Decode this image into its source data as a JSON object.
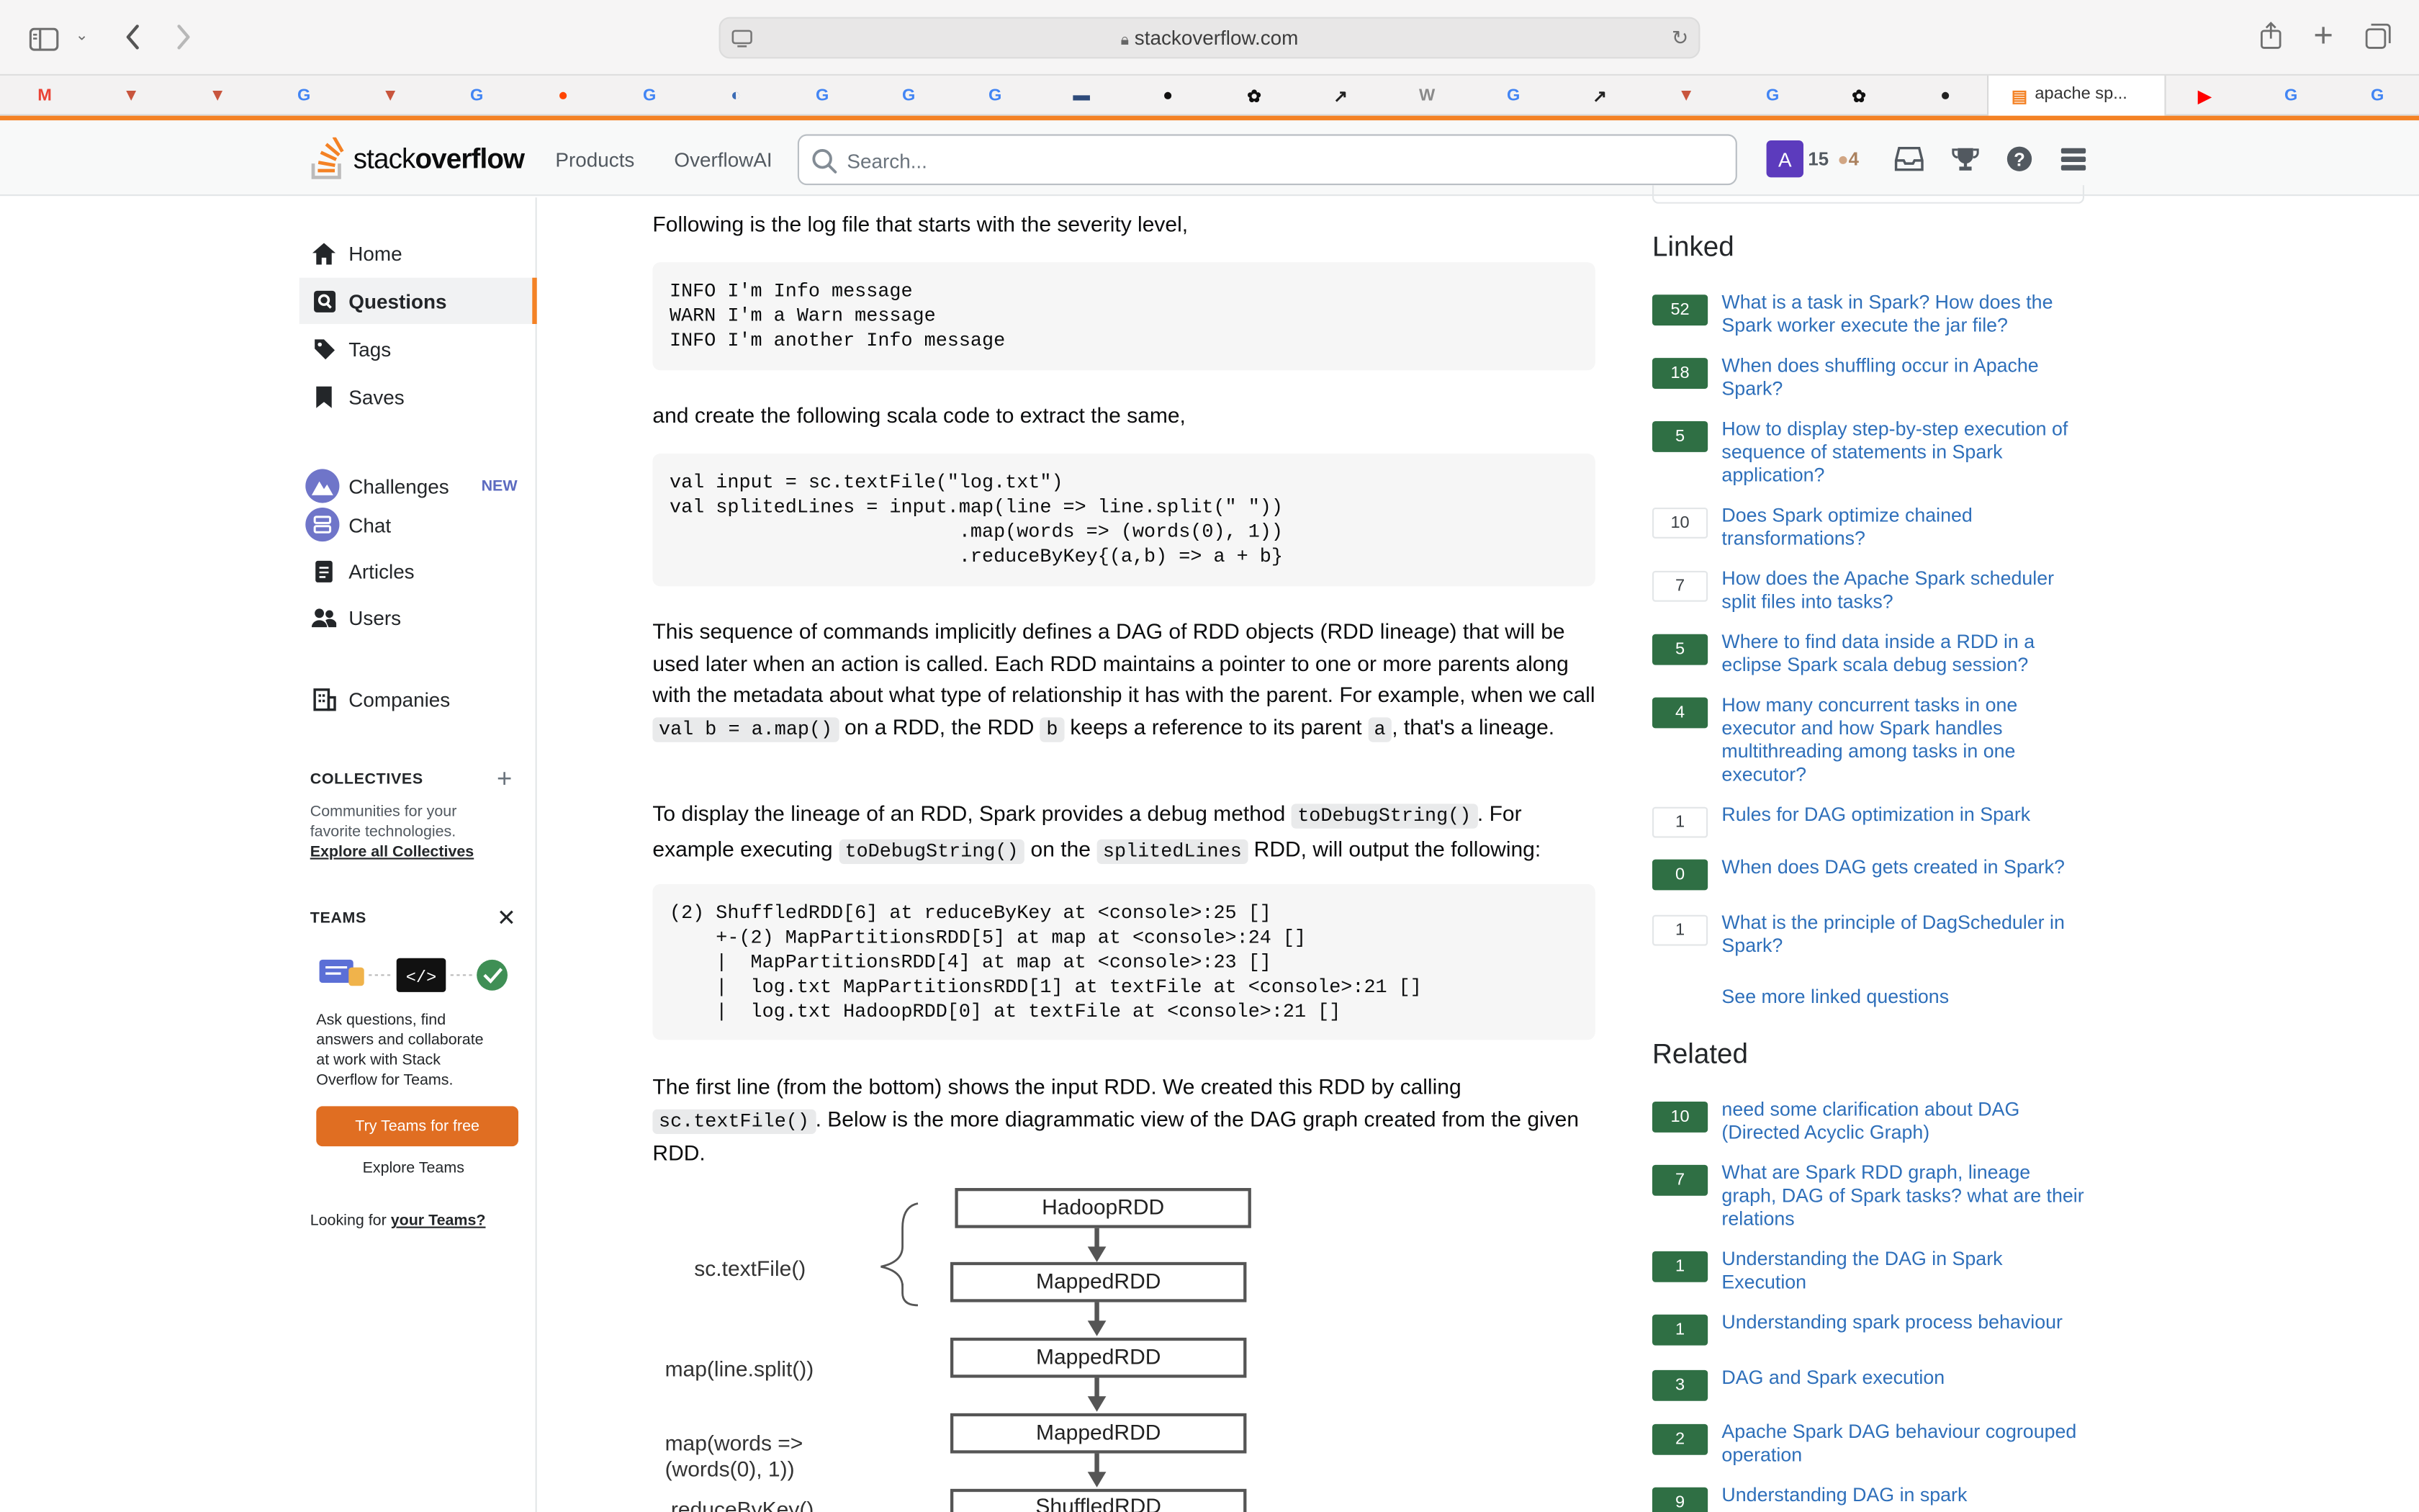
{
  "browser": {
    "url": "stackoverflow.com",
    "active_tab_label": "apache sp...",
    "bookmarks": [
      {
        "icon": "gmail-icon",
        "glyph": "M",
        "color": "#ea4335"
      },
      {
        "icon": "shield-bookmark-icon",
        "glyph": "▼",
        "color": "#c8553d"
      },
      {
        "icon": "shield-bookmark-icon",
        "glyph": "▼",
        "color": "#c8553d"
      },
      {
        "icon": "google-icon",
        "glyph": "G",
        "color": "#4285f4"
      },
      {
        "icon": "shield-bookmark-icon",
        "glyph": "▼",
        "color": "#c8553d"
      },
      {
        "icon": "google-icon",
        "glyph": "G",
        "color": "#4285f4"
      },
      {
        "icon": "reddit-icon",
        "glyph": "●",
        "color": "#ff4500"
      },
      {
        "icon": "google-icon",
        "glyph": "G",
        "color": "#4285f4"
      },
      {
        "icon": "loop-icon",
        "glyph": "◐",
        "color": "#3a6bb5"
      },
      {
        "icon": "google-icon",
        "glyph": "G",
        "color": "#4285f4"
      },
      {
        "icon": "google-icon",
        "glyph": "G",
        "color": "#4285f4"
      },
      {
        "icon": "google-icon",
        "glyph": "G",
        "color": "#4285f4"
      },
      {
        "icon": "window-icon",
        "glyph": "▬",
        "color": "#2d4a7a"
      },
      {
        "icon": "github-icon",
        "glyph": "●",
        "color": "#111"
      },
      {
        "icon": "openai-icon",
        "glyph": "✿",
        "color": "#111"
      },
      {
        "icon": "trend-icon",
        "glyph": "↗",
        "color": "#222"
      },
      {
        "icon": "w-icon",
        "glyph": "W",
        "color": "#8a8a8a"
      },
      {
        "icon": "google-icon",
        "glyph": "G",
        "color": "#4285f4"
      },
      {
        "icon": "trend-icon",
        "glyph": "↗",
        "color": "#222"
      },
      {
        "icon": "shield-bookmark-icon",
        "glyph": "▼",
        "color": "#c8553d"
      },
      {
        "icon": "google-icon",
        "glyph": "G",
        "color": "#4285f4"
      },
      {
        "icon": "openai-icon",
        "glyph": "✿",
        "color": "#111"
      },
      {
        "icon": "dark-circle-icon",
        "glyph": "●",
        "color": "#222"
      }
    ],
    "bookmarks_right": [
      {
        "icon": "youtube-icon",
        "glyph": "▶",
        "color": "#ff0000"
      },
      {
        "icon": "google-icon",
        "glyph": "G",
        "color": "#4285f4"
      },
      {
        "icon": "google-icon",
        "glyph": "G",
        "color": "#4285f4"
      }
    ]
  },
  "header": {
    "logo_text_light": "stack",
    "logo_text_bold": "overflow",
    "nav_products": "Products",
    "nav_overflowai": "OverflowAI",
    "search_placeholder": "Search...",
    "avatar_letter": "A",
    "reputation": "15",
    "bronze_badges": "4",
    "brand_color": "#f48225"
  },
  "sidebar": {
    "items": [
      {
        "label": "Home",
        "icon": "home-icon"
      },
      {
        "label": "Questions",
        "icon": "questions-icon"
      },
      {
        "label": "Tags",
        "icon": "tag-icon"
      },
      {
        "label": "Saves",
        "icon": "bookmark-icon"
      },
      {
        "label": "Challenges",
        "icon": "challenges-icon"
      },
      {
        "label": "Chat",
        "icon": "chat-icon"
      },
      {
        "label": "Articles",
        "icon": "article-icon"
      },
      {
        "label": "Users",
        "icon": "users-icon"
      },
      {
        "label": "Companies",
        "icon": "companies-icon"
      }
    ],
    "new_badge": "NEW",
    "collectives": {
      "heading": "COLLECTIVES",
      "description_line1": "Communities for your",
      "description_line2": "favorite technologies.",
      "link": "Explore all Collectives"
    },
    "teams": {
      "heading": "TEAMS",
      "description_lines": [
        "Ask questions, find",
        "answers and collaborate",
        "at work with Stack",
        "Overflow for Teams."
      ],
      "cta": "Try Teams for free",
      "explore": "Explore Teams",
      "looking_prefix": "Looking for",
      "looking_link": "your Teams?"
    }
  },
  "answer": {
    "p1": "Following is the log file that starts with the severity level,",
    "code1": "INFO I'm Info message\nWARN I'm a Warn message\nINFO I'm another Info message",
    "p2": "and create the following scala code to extract the same,",
    "code2": "val input = sc.textFile(\"log.txt\")\nval splitedLines = input.map(line => line.split(\" \"))\n                         .map(words => (words(0), 1))\n                         .reduceByKey{(a,b) => a + b}",
    "p3_a": "This sequence of commands implicitly defines a DAG of RDD objects (RDD lineage) that will be used later when an action is called. Each RDD maintains a pointer to one or more parents along with the metadata about what type of relationship it has with the parent. For example, when we call ",
    "p3_code1": "val b = a.map()",
    "p3_b": " on a RDD, the RDD ",
    "p3_code2": "b",
    "p3_c": " keeps a reference to its parent ",
    "p3_code3": "a",
    "p3_d": ", that's a lineage.",
    "p4_a": "To display the lineage of an RDD, Spark provides a debug method ",
    "p4_code1": "toDebugString()",
    "p4_b": ". For example executing ",
    "p4_code2": "toDebugString()",
    "p4_c": " on the ",
    "p4_code3": "splitedLines",
    "p4_d": " RDD, will output the following:",
    "code3": "(2) ShuffledRDD[6] at reduceByKey at <console>:25 []\n    +-(2) MapPartitionsRDD[5] at map at <console>:24 []\n    |  MapPartitionsRDD[4] at map at <console>:23 []\n    |  log.txt MapPartitionsRDD[1] at textFile at <console>:21 []\n    |  log.txt HadoopRDD[0] at textFile at <console>:21 []",
    "p5_a": "The first line (from the bottom) shows the input RDD. We created this RDD by calling ",
    "p5_code": "sc.textFile()",
    "p5_b": ". Below is the more diagrammatic view of the DAG graph created from the given RDD.",
    "diagram": {
      "labels": [
        "sc.textFile()",
        "map(line.split())",
        "map(words =>",
        "(words(0), 1))",
        ".reduceByKey()"
      ],
      "boxes": [
        "HadoopRDD",
        "MappedRDD",
        "MappedRDD",
        "MappedRDD",
        "ShuffledRDD"
      ]
    }
  },
  "linked": {
    "title": "Linked",
    "items": [
      {
        "score": "52",
        "accepted": true,
        "text": "What is a task in Spark? How does the Spark worker execute the jar file?"
      },
      {
        "score": "18",
        "accepted": true,
        "text": "When does shuffling occur in Apache Spark?"
      },
      {
        "score": "5",
        "accepted": true,
        "text": "How to display step-by-step execution of sequence of statements in Spark application?"
      },
      {
        "score": "10",
        "accepted": false,
        "text": "Does Spark optimize chained transformations?"
      },
      {
        "score": "7",
        "accepted": false,
        "text": "How does the Apache Spark scheduler split files into tasks?"
      },
      {
        "score": "5",
        "accepted": true,
        "text": "Where to find data inside a RDD in a eclipse Spark scala debug session?"
      },
      {
        "score": "4",
        "accepted": true,
        "text": "How many concurrent tasks in one executor and how Spark handles multithreading among tasks in one executor?"
      },
      {
        "score": "1",
        "accepted": false,
        "text": "Rules for DAG optimization in Spark"
      },
      {
        "score": "0",
        "accepted": true,
        "text": "When does DAG gets created in Spark?"
      },
      {
        "score": "1",
        "accepted": false,
        "text": "What is the principle of DagScheduler in Spark?"
      }
    ],
    "see_more": "See more linked questions"
  },
  "related": {
    "title": "Related",
    "items": [
      {
        "score": "10",
        "accepted": true,
        "text": "need some clarification about DAG (Directed Acyclic Graph)"
      },
      {
        "score": "7",
        "accepted": true,
        "text": "What are Spark RDD graph, lineage graph, DAG of Spark tasks? what are their relations"
      },
      {
        "score": "1",
        "accepted": true,
        "text": "Understanding the DAG in Spark Execution"
      },
      {
        "score": "1",
        "accepted": true,
        "text": "Understanding spark process behaviour"
      },
      {
        "score": "3",
        "accepted": true,
        "text": "DAG and Spark execution"
      },
      {
        "score": "2",
        "accepted": true,
        "text": "Apache Spark DAG behaviour cogrouped operation"
      },
      {
        "score": "9",
        "accepted": true,
        "text": "Understanding DAG in spark"
      }
    ]
  }
}
